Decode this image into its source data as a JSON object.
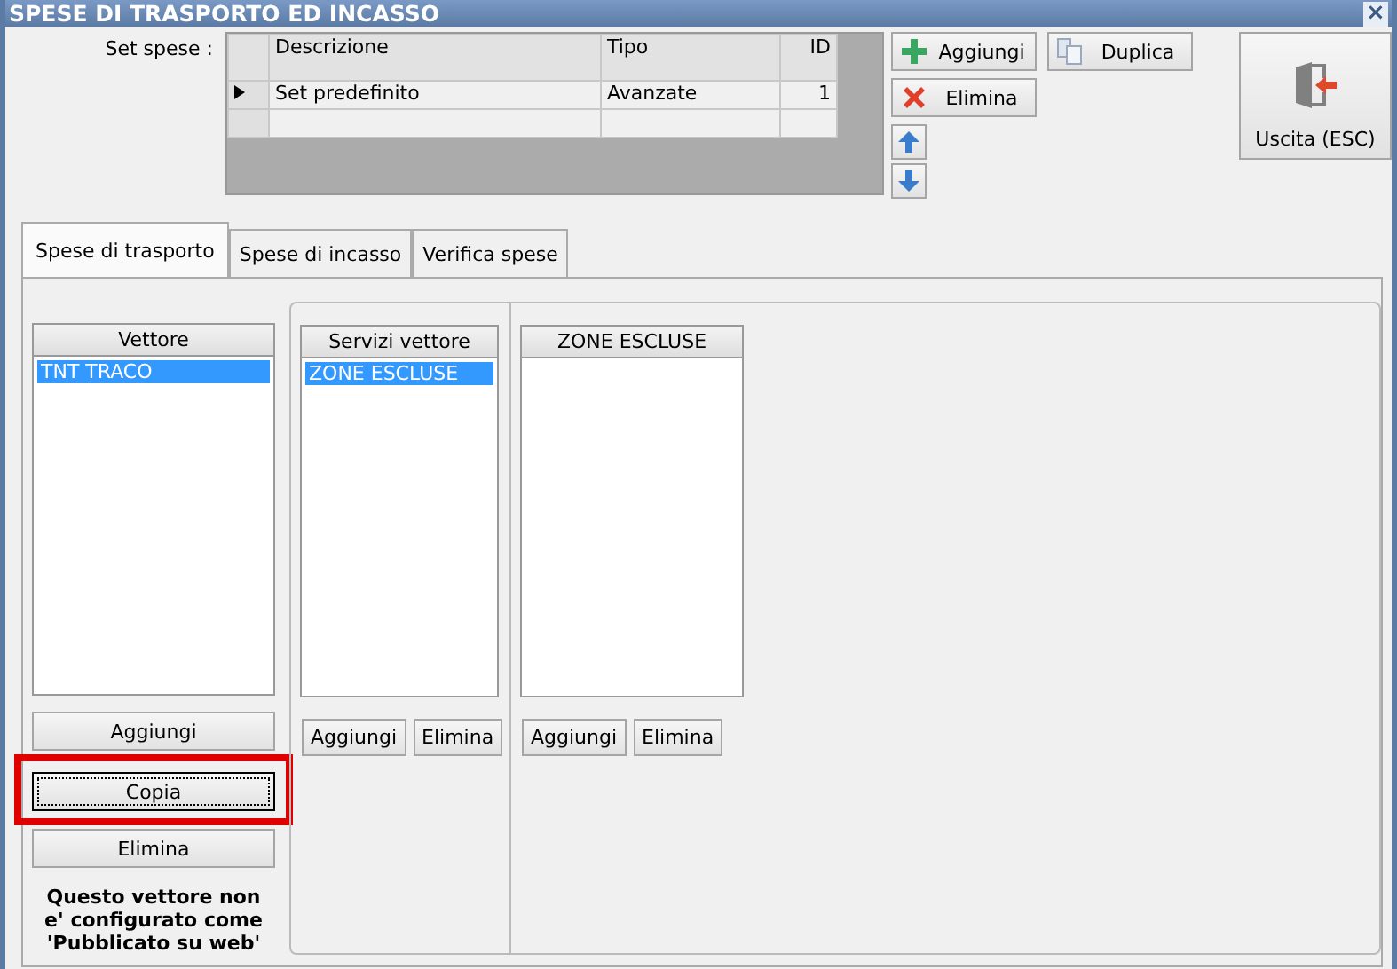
{
  "window": {
    "title": "SPESE DI TRASPORTO ED INCASSO",
    "close": "×"
  },
  "set_spese": {
    "label": "Set spese :",
    "columns": [
      "Descrizione",
      "Tipo",
      "ID"
    ],
    "rows": [
      {
        "cells": [
          "Set predefinito",
          "Avanzate",
          "1"
        ],
        "selected": true
      },
      {
        "cells": [
          "",
          "",
          ""
        ],
        "selected": false
      }
    ]
  },
  "set_buttons": [
    {
      "kind": "add",
      "label": "Aggiungi"
    },
    {
      "kind": "duplicate",
      "label": "Duplica"
    },
    {
      "kind": "delete",
      "label": "Elimina"
    }
  ],
  "exit_button": {
    "label": "Uscita (ESC)"
  },
  "tabs": [
    {
      "label": "Spese di trasporto",
      "selected": true
    },
    {
      "label": "Spese di incasso",
      "selected": false
    },
    {
      "label": "Verifica spese",
      "selected": false
    }
  ],
  "vettore": {
    "header": "Vettore",
    "items": [
      {
        "label": "TNT TRACO",
        "selected": true
      }
    ],
    "buttons": [
      {
        "label": "Aggiungi",
        "focused": false
      },
      {
        "label": "Copia",
        "focused": true
      },
      {
        "label": "Elimina",
        "focused": false
      }
    ],
    "note": "Questo vettore non e' configurato come 'Pubblicato su web'"
  },
  "servizi": {
    "header": "Servizi vettore",
    "items": [
      {
        "label": "ZONE ESCLUSE",
        "selected": true
      }
    ],
    "buttons": [
      "Aggiungi",
      "Elimina"
    ]
  },
  "zone": {
    "header": "ZONE ESCLUSE",
    "buttons": [
      "Aggiungi",
      "Elimina"
    ]
  },
  "highlight": {
    "shown": true
  }
}
